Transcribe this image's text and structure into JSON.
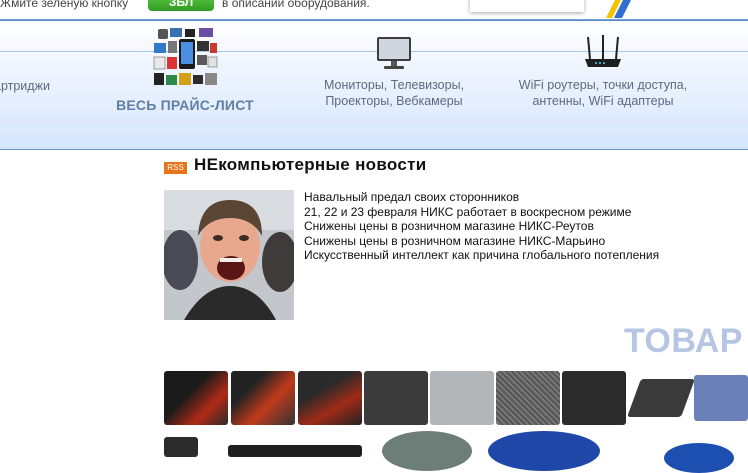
{
  "top_bar": {
    "text_before": "Жмите зеленую кнопку",
    "green_button": "ЗБЛ",
    "text_after": "в описании оборудования."
  },
  "categories": {
    "cartridges": "артриджи",
    "price_list": "ВЕСЬ ПРАЙС-ЛИСТ",
    "monitors_line1": "Мониторы, Телевизоры,",
    "monitors_line2": "Проекторы, Вебкамеры",
    "wifi_line1": "WiFi роутеры, точки доступа,",
    "wifi_line2": "антенны, WiFi адаптеры"
  },
  "news": {
    "rss_label": "RSS",
    "title": "НЕкомпьютерные новости",
    "items": [
      "Навальный предал своих сторонников",
      "21, 22 и 23 февраля НИКС работает в воскресном режиме",
      "Снижены цены в розничном магазине НИКС-Реутов",
      "Снижены цены в розничном магазине НИКС-Марьино",
      "Искусственный интеллект как причина глобального потепления"
    ]
  },
  "products": {
    "heading": "ТОВАР"
  },
  "colors": {
    "accent_blue": "#5f7fa5",
    "green_button": "#3aa92b",
    "rss_orange": "#e8741a"
  }
}
